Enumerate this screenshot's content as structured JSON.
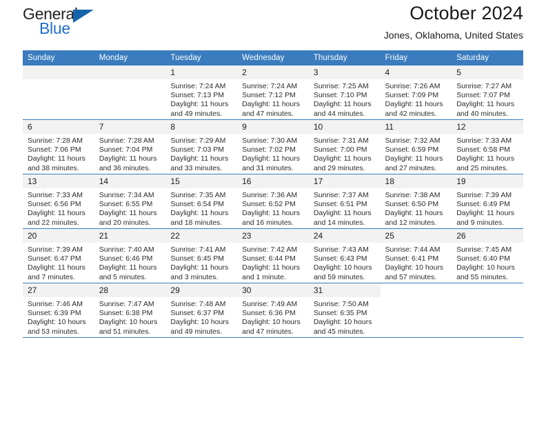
{
  "brand": {
    "name_top": "General",
    "name_bottom": "Blue",
    "triangle_color": "#1464ab",
    "blue_color": "#1f6fc4",
    "dark_color": "#231f20"
  },
  "header": {
    "title": "October 2024",
    "subtitle": "Jones, Oklahoma, United States"
  },
  "theme": {
    "header_bg": "#3a7cbe",
    "header_text": "#ffffff",
    "daynum_bg": "#f2f2f2",
    "grid_line": "#3a7cbe",
    "cell_text": "#2b2b2b"
  },
  "weekdays": [
    "Sunday",
    "Monday",
    "Tuesday",
    "Wednesday",
    "Thursday",
    "Friday",
    "Saturday"
  ],
  "labels": {
    "sunrise_prefix": "Sunrise:",
    "sunset_prefix": "Sunset:",
    "daylight_prefix": "Daylight:"
  },
  "weeks": [
    [
      {
        "day": "",
        "empty": true
      },
      {
        "day": "",
        "empty": true
      },
      {
        "day": "1",
        "sunrise": "Sunrise: 7:24 AM",
        "sunset": "Sunset: 7:13 PM",
        "daylight_1": "Daylight: 11 hours",
        "daylight_2": "and 49 minutes."
      },
      {
        "day": "2",
        "sunrise": "Sunrise: 7:24 AM",
        "sunset": "Sunset: 7:12 PM",
        "daylight_1": "Daylight: 11 hours",
        "daylight_2": "and 47 minutes."
      },
      {
        "day": "3",
        "sunrise": "Sunrise: 7:25 AM",
        "sunset": "Sunset: 7:10 PM",
        "daylight_1": "Daylight: 11 hours",
        "daylight_2": "and 44 minutes."
      },
      {
        "day": "4",
        "sunrise": "Sunrise: 7:26 AM",
        "sunset": "Sunset: 7:09 PM",
        "daylight_1": "Daylight: 11 hours",
        "daylight_2": "and 42 minutes."
      },
      {
        "day": "5",
        "sunrise": "Sunrise: 7:27 AM",
        "sunset": "Sunset: 7:07 PM",
        "daylight_1": "Daylight: 11 hours",
        "daylight_2": "and 40 minutes."
      }
    ],
    [
      {
        "day": "6",
        "sunrise": "Sunrise: 7:28 AM",
        "sunset": "Sunset: 7:06 PM",
        "daylight_1": "Daylight: 11 hours",
        "daylight_2": "and 38 minutes."
      },
      {
        "day": "7",
        "sunrise": "Sunrise: 7:28 AM",
        "sunset": "Sunset: 7:04 PM",
        "daylight_1": "Daylight: 11 hours",
        "daylight_2": "and 36 minutes."
      },
      {
        "day": "8",
        "sunrise": "Sunrise: 7:29 AM",
        "sunset": "Sunset: 7:03 PM",
        "daylight_1": "Daylight: 11 hours",
        "daylight_2": "and 33 minutes."
      },
      {
        "day": "9",
        "sunrise": "Sunrise: 7:30 AM",
        "sunset": "Sunset: 7:02 PM",
        "daylight_1": "Daylight: 11 hours",
        "daylight_2": "and 31 minutes."
      },
      {
        "day": "10",
        "sunrise": "Sunrise: 7:31 AM",
        "sunset": "Sunset: 7:00 PM",
        "daylight_1": "Daylight: 11 hours",
        "daylight_2": "and 29 minutes."
      },
      {
        "day": "11",
        "sunrise": "Sunrise: 7:32 AM",
        "sunset": "Sunset: 6:59 PM",
        "daylight_1": "Daylight: 11 hours",
        "daylight_2": "and 27 minutes."
      },
      {
        "day": "12",
        "sunrise": "Sunrise: 7:33 AM",
        "sunset": "Sunset: 6:58 PM",
        "daylight_1": "Daylight: 11 hours",
        "daylight_2": "and 25 minutes."
      }
    ],
    [
      {
        "day": "13",
        "sunrise": "Sunrise: 7:33 AM",
        "sunset": "Sunset: 6:56 PM",
        "daylight_1": "Daylight: 11 hours",
        "daylight_2": "and 22 minutes."
      },
      {
        "day": "14",
        "sunrise": "Sunrise: 7:34 AM",
        "sunset": "Sunset: 6:55 PM",
        "daylight_1": "Daylight: 11 hours",
        "daylight_2": "and 20 minutes."
      },
      {
        "day": "15",
        "sunrise": "Sunrise: 7:35 AM",
        "sunset": "Sunset: 6:54 PM",
        "daylight_1": "Daylight: 11 hours",
        "daylight_2": "and 18 minutes."
      },
      {
        "day": "16",
        "sunrise": "Sunrise: 7:36 AM",
        "sunset": "Sunset: 6:52 PM",
        "daylight_1": "Daylight: 11 hours",
        "daylight_2": "and 16 minutes."
      },
      {
        "day": "17",
        "sunrise": "Sunrise: 7:37 AM",
        "sunset": "Sunset: 6:51 PM",
        "daylight_1": "Daylight: 11 hours",
        "daylight_2": "and 14 minutes."
      },
      {
        "day": "18",
        "sunrise": "Sunrise: 7:38 AM",
        "sunset": "Sunset: 6:50 PM",
        "daylight_1": "Daylight: 11 hours",
        "daylight_2": "and 12 minutes."
      },
      {
        "day": "19",
        "sunrise": "Sunrise: 7:39 AM",
        "sunset": "Sunset: 6:49 PM",
        "daylight_1": "Daylight: 11 hours",
        "daylight_2": "and 9 minutes."
      }
    ],
    [
      {
        "day": "20",
        "sunrise": "Sunrise: 7:39 AM",
        "sunset": "Sunset: 6:47 PM",
        "daylight_1": "Daylight: 11 hours",
        "daylight_2": "and 7 minutes."
      },
      {
        "day": "21",
        "sunrise": "Sunrise: 7:40 AM",
        "sunset": "Sunset: 6:46 PM",
        "daylight_1": "Daylight: 11 hours",
        "daylight_2": "and 5 minutes."
      },
      {
        "day": "22",
        "sunrise": "Sunrise: 7:41 AM",
        "sunset": "Sunset: 6:45 PM",
        "daylight_1": "Daylight: 11 hours",
        "daylight_2": "and 3 minutes."
      },
      {
        "day": "23",
        "sunrise": "Sunrise: 7:42 AM",
        "sunset": "Sunset: 6:44 PM",
        "daylight_1": "Daylight: 11 hours",
        "daylight_2": "and 1 minute."
      },
      {
        "day": "24",
        "sunrise": "Sunrise: 7:43 AM",
        "sunset": "Sunset: 6:43 PM",
        "daylight_1": "Daylight: 10 hours",
        "daylight_2": "and 59 minutes."
      },
      {
        "day": "25",
        "sunrise": "Sunrise: 7:44 AM",
        "sunset": "Sunset: 6:41 PM",
        "daylight_1": "Daylight: 10 hours",
        "daylight_2": "and 57 minutes."
      },
      {
        "day": "26",
        "sunrise": "Sunrise: 7:45 AM",
        "sunset": "Sunset: 6:40 PM",
        "daylight_1": "Daylight: 10 hours",
        "daylight_2": "and 55 minutes."
      }
    ],
    [
      {
        "day": "27",
        "sunrise": "Sunrise: 7:46 AM",
        "sunset": "Sunset: 6:39 PM",
        "daylight_1": "Daylight: 10 hours",
        "daylight_2": "and 53 minutes."
      },
      {
        "day": "28",
        "sunrise": "Sunrise: 7:47 AM",
        "sunset": "Sunset: 6:38 PM",
        "daylight_1": "Daylight: 10 hours",
        "daylight_2": "and 51 minutes."
      },
      {
        "day": "29",
        "sunrise": "Sunrise: 7:48 AM",
        "sunset": "Sunset: 6:37 PM",
        "daylight_1": "Daylight: 10 hours",
        "daylight_2": "and 49 minutes."
      },
      {
        "day": "30",
        "sunrise": "Sunrise: 7:49 AM",
        "sunset": "Sunset: 6:36 PM",
        "daylight_1": "Daylight: 10 hours",
        "daylight_2": "and 47 minutes."
      },
      {
        "day": "31",
        "sunrise": "Sunrise: 7:50 AM",
        "sunset": "Sunset: 6:35 PM",
        "daylight_1": "Daylight: 10 hours",
        "daylight_2": "and 45 minutes."
      },
      {
        "day": "",
        "blank": true
      },
      {
        "day": "",
        "blank": true
      }
    ]
  ]
}
